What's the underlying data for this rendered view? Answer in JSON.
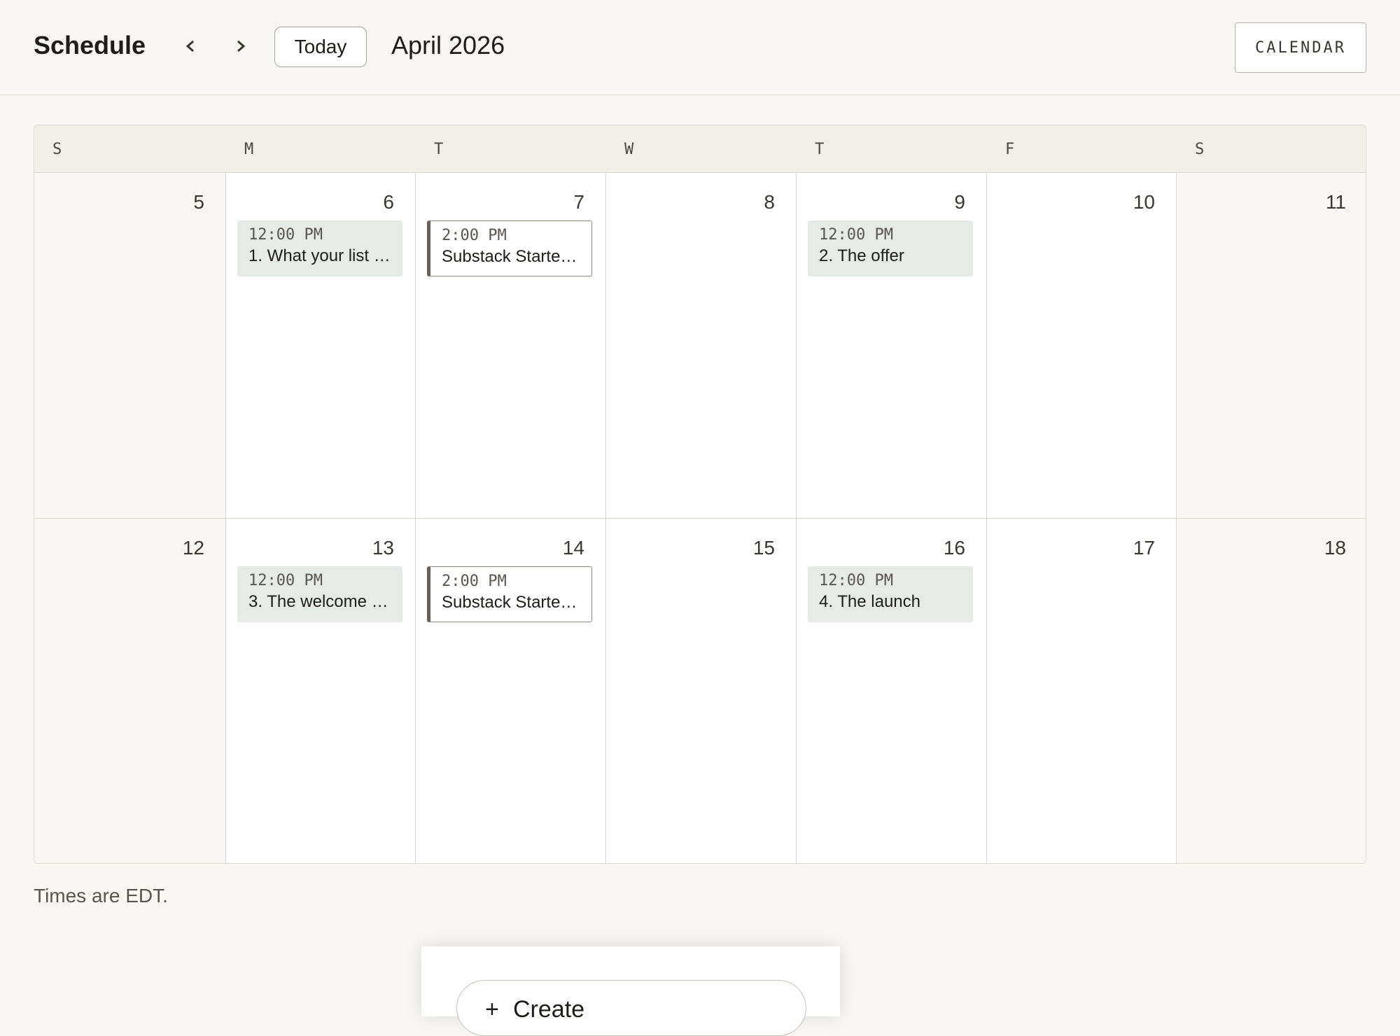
{
  "header": {
    "title": "Schedule",
    "today_label": "Today",
    "month_label": "April 2026",
    "calendar_button": "CALENDAR"
  },
  "days_of_week": [
    "S",
    "M",
    "T",
    "W",
    "T",
    "F",
    "S"
  ],
  "weeks": [
    {
      "days": [
        {
          "num": "5"
        },
        {
          "num": "6",
          "event": {
            "time": "12:00 PM",
            "title": "1. What your list …",
            "style": "filled"
          }
        },
        {
          "num": "7",
          "event": {
            "time": "2:00 PM",
            "title": "Substack Starter…",
            "style": "outlined"
          }
        },
        {
          "num": "8"
        },
        {
          "num": "9",
          "event": {
            "time": "12:00 PM",
            "title": "2. The offer",
            "style": "filled"
          }
        },
        {
          "num": "10"
        },
        {
          "num": "11"
        }
      ]
    },
    {
      "days": [
        {
          "num": "12"
        },
        {
          "num": "13",
          "event": {
            "time": "12:00 PM",
            "title": "3. The welcome …",
            "style": "filled"
          }
        },
        {
          "num": "14",
          "event": {
            "time": "2:00 PM",
            "title": "Substack Starter…",
            "style": "outlined"
          }
        },
        {
          "num": "15"
        },
        {
          "num": "16",
          "event": {
            "time": "12:00 PM",
            "title": "4. The launch",
            "style": "filled"
          }
        },
        {
          "num": "17"
        },
        {
          "num": "18"
        }
      ]
    }
  ],
  "footnote": "Times are EDT.",
  "create_panel": {
    "plus_icon": "+",
    "create_label": "Create"
  },
  "colors": {
    "page_bg": "#f8f7f3",
    "header_row_bg": "#f1efe8",
    "event_fill": "#e6ebe8",
    "event_accent": "#6b5e54"
  }
}
